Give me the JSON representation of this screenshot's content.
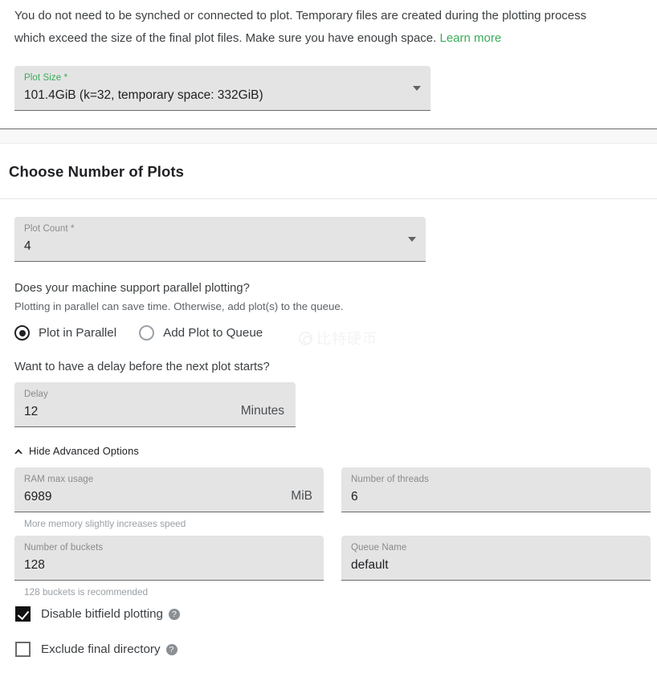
{
  "intro": {
    "text_part1": "You do not need to be synched or connected to plot. Temporary files are created during the plotting process which exceed the size of the final plot files. Make sure you have enough space. ",
    "learn_more_label": "Learn more",
    "link_color": "#3aac59"
  },
  "plot_size_field": {
    "label": "Plot Size *",
    "value": "101.4GiB (k=32, temporary space: 332GiB)",
    "caret_icon": "chevron-down-icon",
    "label_color": "#3aac59"
  },
  "section": {
    "title": "Choose Number of Plots"
  },
  "plot_count_field": {
    "label": "Plot Count *",
    "value": "4",
    "caret_icon": "chevron-down-icon"
  },
  "parallel": {
    "question": "Does your machine support parallel plotting?",
    "subtext": "Plotting in parallel can save time. Otherwise, add plot(s) to the queue.",
    "options": [
      {
        "label": "Plot in Parallel",
        "selected": true
      },
      {
        "label": "Add Plot to Queue",
        "selected": false
      }
    ]
  },
  "delay": {
    "question": "Want to have a delay before the next plot starts?",
    "label": "Delay",
    "value": "12",
    "suffix": "Minutes"
  },
  "advanced": {
    "toggle_label": "Hide Advanced Options",
    "toggle_icon": "chevron-up-icon",
    "fields": [
      {
        "label": "RAM max usage",
        "value": "6989",
        "suffix": "MiB",
        "helper": "More memory slightly increases speed"
      },
      {
        "label": "Number of threads",
        "value": "6",
        "suffix": "",
        "helper": ""
      },
      {
        "label": "Number of buckets",
        "value": "128",
        "suffix": "",
        "helper": "128 buckets is recommended"
      },
      {
        "label": "Queue Name",
        "value": "default",
        "suffix": "",
        "helper": ""
      }
    ]
  },
  "checkboxes": [
    {
      "label": "Disable bitfield plotting",
      "checked": true,
      "help_icon": "help-circle-icon",
      "help_glyph": "?"
    },
    {
      "label": "Exclude final directory",
      "checked": false,
      "help_icon": "help-circle-icon",
      "help_glyph": "?"
    }
  ],
  "watermark": {
    "text": "比特硬币",
    "logo_icon": "weibo-logo-icon"
  }
}
